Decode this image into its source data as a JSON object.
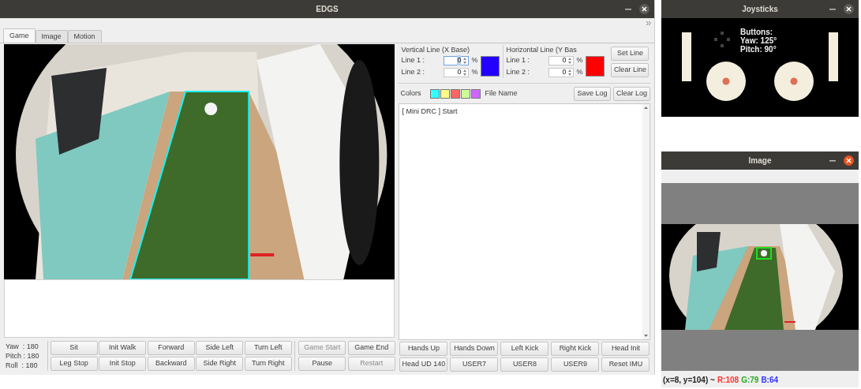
{
  "main_window": {
    "title": "EDGS",
    "tabs": [
      {
        "label": "Game",
        "selected": true
      },
      {
        "label": "Image",
        "selected": false
      },
      {
        "label": "Motion",
        "selected": false
      }
    ],
    "imu": [
      "Yaw  : 180",
      "Pitch : 180",
      "Roll  : 180"
    ],
    "motion_buttons": [
      {
        "label": "Sit"
      },
      {
        "label": "Init Walk"
      },
      {
        "label": "Forward"
      },
      {
        "label": "Side Left"
      },
      {
        "label": "Turn Left"
      },
      {
        "label": "Leg Stop"
      },
      {
        "label": "Init Stop"
      },
      {
        "label": "Backward"
      },
      {
        "label": "Side Right"
      },
      {
        "label": "Turn Right"
      }
    ],
    "game_buttons": [
      {
        "label": "Game Start",
        "disabled": true
      },
      {
        "label": "Game End",
        "disabled": false
      },
      {
        "label": "Pause",
        "disabled": false
      },
      {
        "label": "Restart",
        "disabled": true
      }
    ],
    "vertical_line": {
      "title": "Vertical Line (X Base)",
      "color": "#2200ff",
      "lines": [
        {
          "label": "Line 1 :",
          "value": "0",
          "unit": "%",
          "focused": true
        },
        {
          "label": "Line 2 :",
          "value": "0",
          "unit": "%",
          "focused": false
        }
      ]
    },
    "horizontal_line": {
      "title": "Horizontal Line (Y Bas",
      "color": "#ff0000",
      "lines": [
        {
          "label": "Line 1 :",
          "value": "0",
          "unit": "%",
          "focused": false
        },
        {
          "label": "Line 2 :",
          "value": "0",
          "unit": "%",
          "focused": false
        }
      ]
    },
    "line_buttons": [
      "Set Line",
      "Clear Line"
    ],
    "colors_label": "Colors",
    "palette": [
      {
        "color": "#33ffff"
      },
      {
        "color": "#ffff88"
      },
      {
        "color": "#ff6666"
      },
      {
        "color": "#ccff99"
      },
      {
        "color": "#cc66ff"
      }
    ],
    "file_name_label": "File Name",
    "log_buttons": [
      "Save Log",
      "Clear Log"
    ],
    "log": [
      "[ Mini DRC ] Start"
    ],
    "action_buttons": [
      "Hands Up",
      "Hands Down",
      "Left Kick",
      "Right Kick",
      "Head Init",
      "Head UD 140",
      "USER7",
      "USER8",
      "USER9",
      "Reset IMU"
    ]
  },
  "joysticks_window": {
    "title": "Joysticks",
    "lines": [
      "Buttons:",
      "Yaw: 125°",
      "Pitch: 90°"
    ]
  },
  "image_window": {
    "title": "Image",
    "status": [
      {
        "text": "(x=8, y=104) ~",
        "color": "#222222"
      },
      {
        "text": "R:108",
        "color": "#ff3333"
      },
      {
        "text": "G:79",
        "color": "#22aa22"
      },
      {
        "text": "B:64",
        "color": "#3333ff"
      }
    ]
  }
}
